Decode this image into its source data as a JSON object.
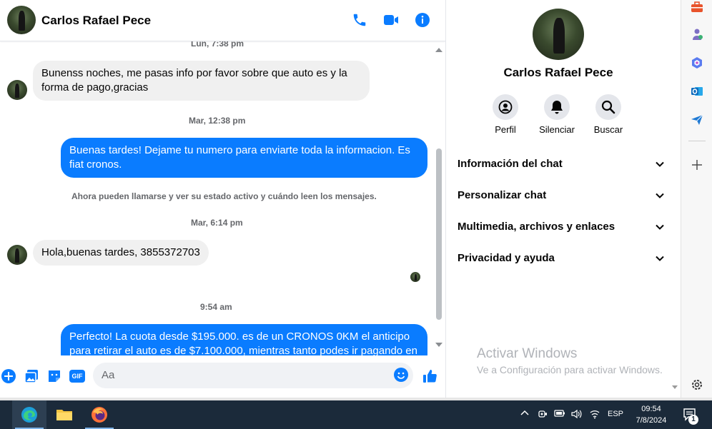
{
  "contact": {
    "name": "Carlos Rafael Pece"
  },
  "header": {
    "name": "Carlos Rafael Pece"
  },
  "messages": {
    "ts1": "Lun, 7:38 pm",
    "m1_line1": "Bunenss noches, me pasas info por favor sobre que auto es y la",
    "m1_line2": "forma de pago,gracias",
    "ts2": "Mar, 12:38 pm",
    "m2_line1": "Buenas tardes! Dejame tu numero para enviarte toda la informacion. Es",
    "m2_line2": "fiat cronos.",
    "notice": "Ahora pueden llamarse y ver su estado activo y cuándo leen los mensajes.",
    "ts3": "Mar, 6:14 pm",
    "m3": "Hola,buenas tardes, 3855372703",
    "ts4": "9:54 am",
    "m4_line1": "Perfecto! La cuota desde $195.000. es de un CRONOS 0KM el anticipo",
    "m4_line2": "para retirar el auto es de $7.100.000, mientras tanto podes ir pagando en"
  },
  "composer": {
    "placeholder": "Aa",
    "gif": "GIF"
  },
  "info": {
    "name": "Carlos Rafael Pece",
    "actions": [
      "Perfil",
      "Silenciar",
      "Buscar"
    ],
    "sections": [
      "Información del chat",
      "Personalizar chat",
      "Multimedia, archivos y enlaces",
      "Privacidad y ayuda"
    ],
    "watermark_title": "Activar Windows",
    "watermark_sub": "Ve a Configuración para activar Windows."
  },
  "taskbar": {
    "lang": "ESP",
    "time": "09:54",
    "date": "7/8/2024",
    "notif_count": "1"
  },
  "colors": {
    "accent": "#0a7cff",
    "incoming_bubble": "#f0f0f0",
    "taskbar": "#1b2a3a"
  }
}
